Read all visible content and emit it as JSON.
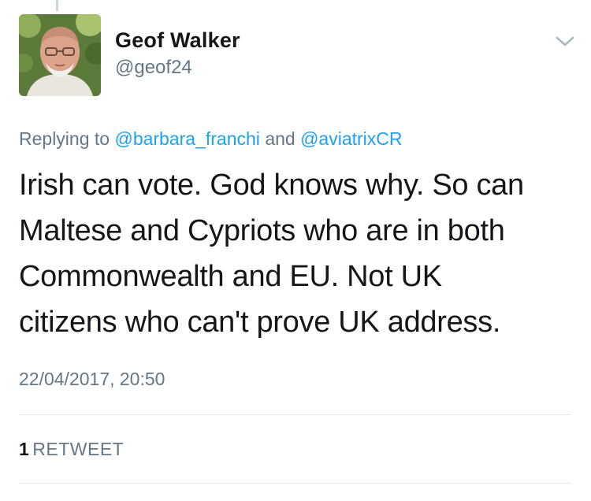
{
  "tweet": {
    "author": {
      "display_name": "Geof Walker",
      "handle": "@geof24"
    },
    "reply": {
      "prefix": "Replying to",
      "mentions": [
        "@barbara_franchi",
        "@aviatrixCR"
      ],
      "conjunction": "and"
    },
    "text_lines": [
      "Irish can vote. God knows why. So can",
      "Maltese and Cypriots who are in both",
      "Commonwealth and EU. Not UK",
      "citizens who can't prove UK address."
    ],
    "timestamp": "22/04/2017, 20:50",
    "stats": {
      "retweet_count": "1",
      "retweet_label": "RETWEET"
    }
  },
  "icons": {
    "menu": "chevron-down-icon",
    "avatar": "profile-photo"
  },
  "colors": {
    "link": "#1da1f2",
    "secondary_text": "#657786",
    "primary_text": "#14171a",
    "divider": "#e1e8ed"
  }
}
